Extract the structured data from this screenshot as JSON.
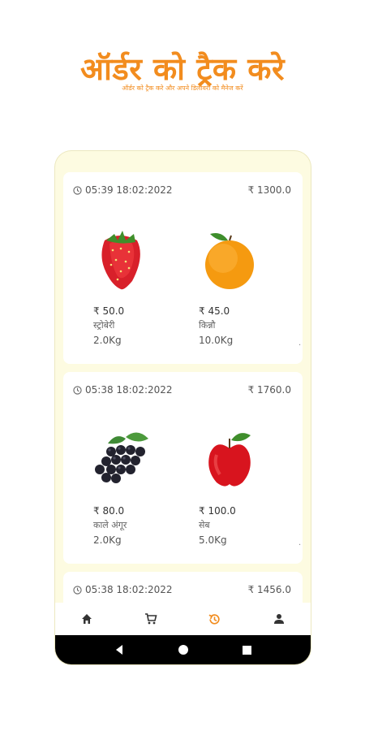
{
  "hero": {
    "title": "ऑर्डर को ट्रैक करे",
    "subtitle": "ऑर्डर को ट्रैक करे और अपने डिलीवरी को मैनेज करें"
  },
  "colors": {
    "accent": "#f28c1e",
    "phone_background": "#fdfbe1",
    "card_background": "#ffffff",
    "nav_active": "#f28c1e",
    "nav_inactive": "#333333"
  },
  "orders": [
    {
      "time": "05:39 18:02:2022",
      "total": "₹ 1300.0",
      "items": [
        {
          "image": "strawberry-image",
          "price": "₹ 50.0",
          "name": "स्ट्रोबेरी",
          "qty": "2.0Kg"
        },
        {
          "image": "orange-image",
          "price": "₹ 45.0",
          "name": "किन्नौ",
          "qty": "10.0Kg"
        }
      ]
    },
    {
      "time": "05:38 18:02:2022",
      "total": "₹ 1760.0",
      "items": [
        {
          "image": "grapes-image",
          "price": "₹ 80.0",
          "name": "काले अंगूर",
          "qty": "2.0Kg"
        },
        {
          "image": "apple-image",
          "price": "₹ 100.0",
          "name": "सेब",
          "qty": "5.0Kg"
        }
      ]
    },
    {
      "time": "05:38 18:02:2022",
      "total": "₹ 1456.0"
    }
  ],
  "nav": {
    "items": [
      {
        "icon": "home-icon",
        "active": false
      },
      {
        "icon": "cart-icon",
        "active": false
      },
      {
        "icon": "history-icon",
        "active": true
      },
      {
        "icon": "profile-icon",
        "active": false
      }
    ]
  },
  "system_nav": {
    "items": [
      "back-icon",
      "home-circle-icon",
      "recents-icon"
    ]
  }
}
